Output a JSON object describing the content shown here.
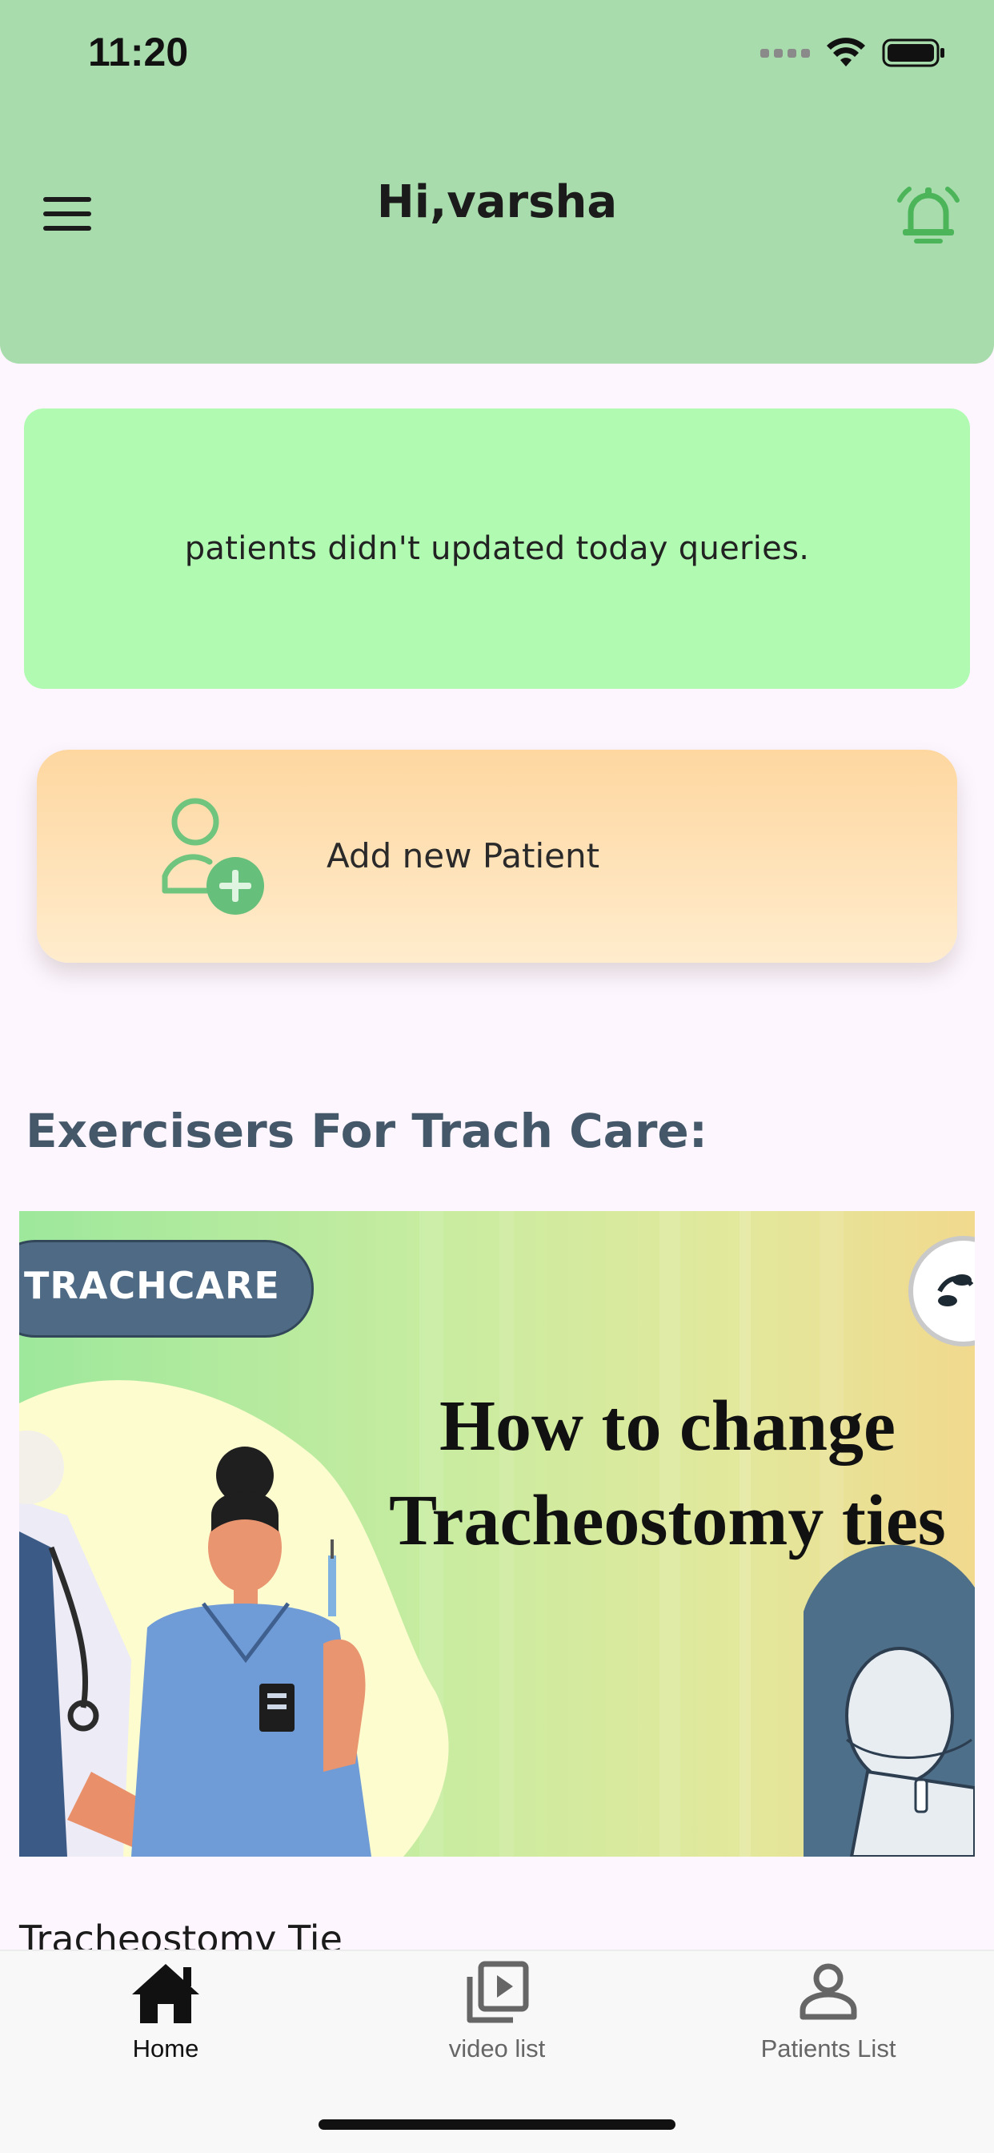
{
  "status_bar": {
    "time": "11:20"
  },
  "header": {
    "greeting": "Hi,varsha"
  },
  "alert": {
    "message": "patients didn't updated today queries."
  },
  "add_patient": {
    "label": "Add new Patient"
  },
  "section": {
    "title": "Exercisers For Trach Care:"
  },
  "video": {
    "thumbnail_tag": "TRACHCARE",
    "thumbnail_heading_line1": "How to change",
    "thumbnail_heading_line2": "Tracheostomy ties",
    "title": "Tracheostomy Tie"
  },
  "bottom_nav": {
    "items": [
      {
        "label": "Home",
        "icon": "home-icon",
        "active": true
      },
      {
        "label": "video list",
        "icon": "video-library-icon",
        "active": false
      },
      {
        "label": "Patients List",
        "icon": "person-icon",
        "active": false
      }
    ]
  },
  "colors": {
    "header_bg": "#a8dcac",
    "alert_bg": "#b0fbb1",
    "accent_green": "#4cb55a",
    "section_title": "#44586a"
  }
}
